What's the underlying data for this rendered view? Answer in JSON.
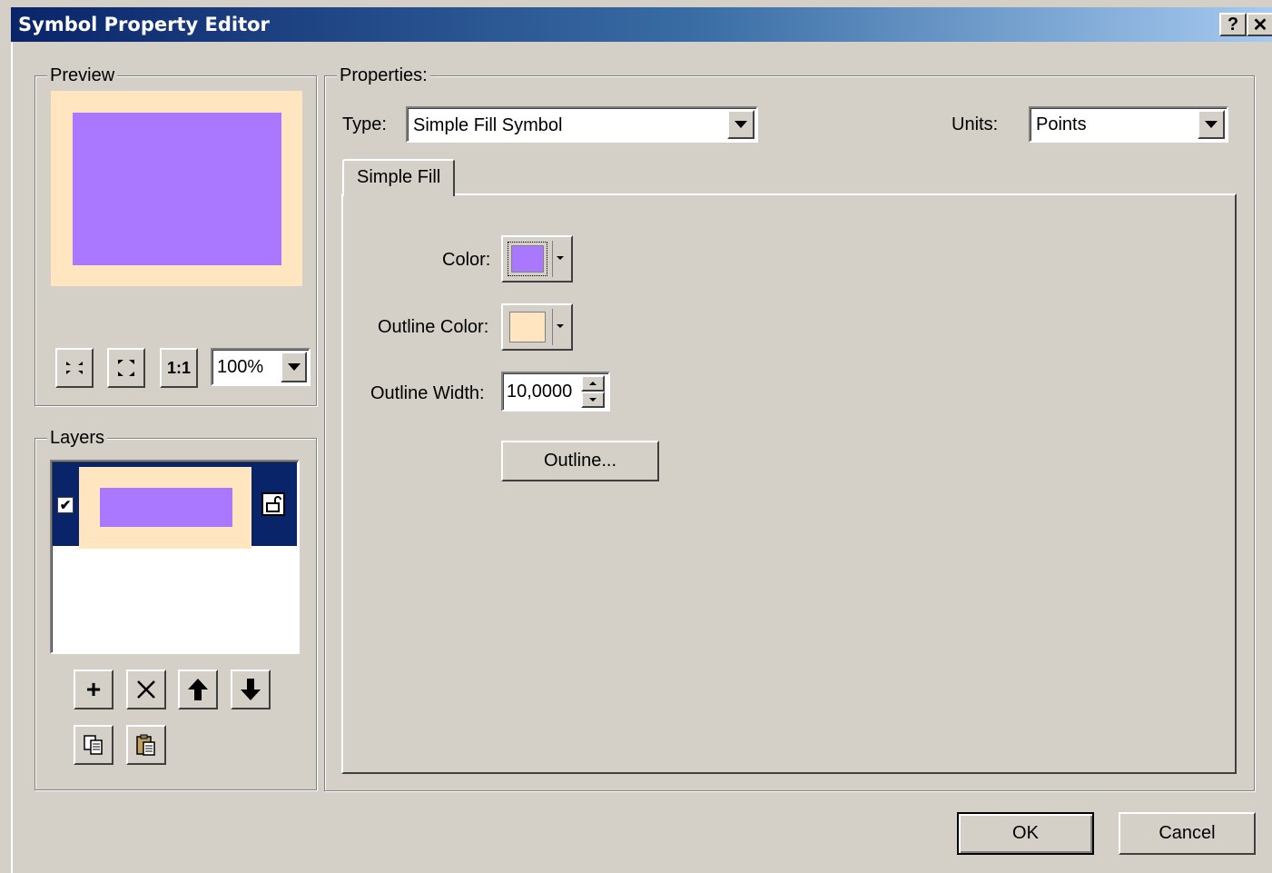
{
  "window": {
    "title": "Symbol Property Editor",
    "help_glyph": "?",
    "close_glyph": "✕"
  },
  "preview": {
    "legend": "Preview",
    "fill_color": "#aa77ff",
    "outline_color": "#ffe6c0",
    "zoom": "100%",
    "tools": [
      "shrink-icon",
      "expand-icon",
      "actual-size-icon"
    ]
  },
  "layers": {
    "legend": "Layers",
    "items": [
      {
        "visible": true,
        "fill_color": "#aa77ff",
        "outline_color": "#ffe6c0",
        "selected": true
      }
    ],
    "buttons": [
      "add-icon",
      "delete-icon",
      "move-up-icon",
      "move-down-icon",
      "copy-icon",
      "paste-icon"
    ]
  },
  "properties": {
    "legend": "Properties:",
    "type_label": "Type:",
    "type_value": "Simple Fill Symbol",
    "units_label": "Units:",
    "units_value": "Points",
    "tab_label": "Simple Fill",
    "color_label": "Color:",
    "color_value": "#aa77ff",
    "outline_color_label": "Outline Color:",
    "outline_color_value": "#ffe6c0",
    "outline_width_label": "Outline Width:",
    "outline_width_value": "10,0000",
    "outline_button": "Outline..."
  },
  "footer": {
    "ok": "OK",
    "cancel": "Cancel"
  }
}
